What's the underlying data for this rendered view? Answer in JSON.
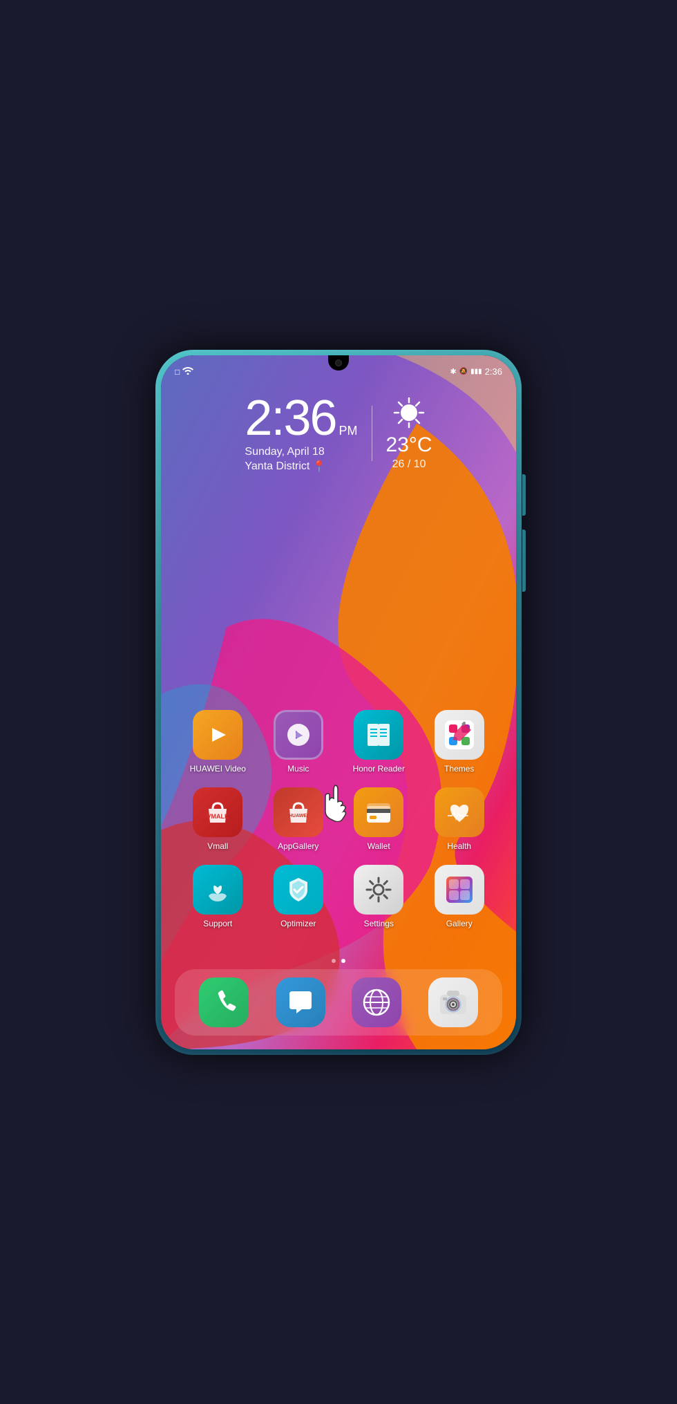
{
  "phone": {
    "notch": true
  },
  "statusBar": {
    "left": {
      "sim": "□",
      "wifi": "wifi"
    },
    "right": {
      "bluetooth": "BT",
      "mute": "🔕",
      "battery": "▮▮▮",
      "time": "2:36"
    }
  },
  "clock": {
    "time": "2:36",
    "ampm": "PM",
    "date": "Sunday, April 18",
    "location": "Yanta District"
  },
  "weather": {
    "temp": "23°C",
    "range": "26 / 10"
  },
  "appRows": [
    {
      "id": "row1",
      "apps": [
        {
          "id": "huawei-video",
          "label": "HUAWEI Video",
          "iconClass": "icon-huawei-video"
        },
        {
          "id": "music",
          "label": "Music",
          "iconClass": "icon-music"
        },
        {
          "id": "honor-reader",
          "label": "Honor Reader",
          "iconClass": "icon-honor-reader"
        },
        {
          "id": "themes",
          "label": "Themes",
          "iconClass": "icon-themes"
        }
      ]
    },
    {
      "id": "row2",
      "apps": [
        {
          "id": "vmall",
          "label": "Vmall",
          "iconClass": "icon-vmall"
        },
        {
          "id": "appgallery",
          "label": "AppGallery",
          "iconClass": "icon-appgallery"
        },
        {
          "id": "wallet",
          "label": "Wallet",
          "iconClass": "icon-wallet"
        },
        {
          "id": "health",
          "label": "Health",
          "iconClass": "icon-health"
        }
      ]
    },
    {
      "id": "row3",
      "apps": [
        {
          "id": "support",
          "label": "Support",
          "iconClass": "icon-support"
        },
        {
          "id": "optimizer",
          "label": "Optimizer",
          "iconClass": "icon-optimizer"
        },
        {
          "id": "settings",
          "label": "Settings",
          "iconClass": "icon-settings"
        },
        {
          "id": "gallery",
          "label": "Gallery",
          "iconClass": "icon-gallery"
        }
      ]
    }
  ],
  "dock": {
    "apps": [
      {
        "id": "phone",
        "iconClass": "icon-phone"
      },
      {
        "id": "messages",
        "iconClass": "icon-messages"
      },
      {
        "id": "browser",
        "iconClass": "icon-browser"
      },
      {
        "id": "camera",
        "iconClass": "icon-camera"
      }
    ]
  },
  "pageDots": [
    {
      "active": false
    },
    {
      "active": true
    }
  ],
  "labels": {
    "clock_time": "2:36",
    "clock_ampm": "PM",
    "clock_date": "Sunday, April 18",
    "clock_location": "Yanta District",
    "weather_temp": "23°C",
    "weather_range": "26 / 10",
    "status_time": "2:36",
    "app_huawei_video": "HUAWEI Video",
    "app_music": "Music",
    "app_honor_reader": "Honor Reader",
    "app_themes": "Themes",
    "app_vmall": "Vmall",
    "app_appgallery": "AppGallery",
    "app_wallet": "Wallet",
    "app_health": "Health",
    "app_support": "Support",
    "app_optimizer": "Optimizer",
    "app_settings": "Settings",
    "app_gallery": "Gallery"
  }
}
